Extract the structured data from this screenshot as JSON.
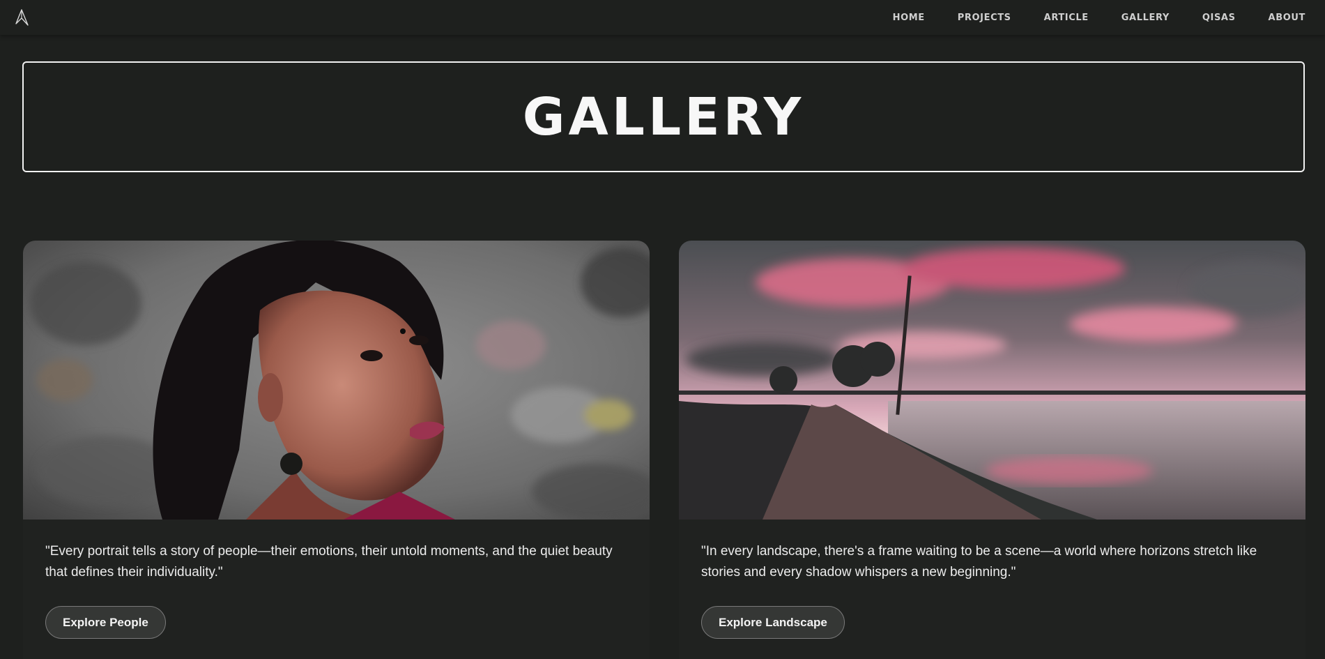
{
  "nav": {
    "items": [
      "HOME",
      "PROJECTS",
      "ARTICLE",
      "GALLERY",
      "QISAS",
      "ABOUT"
    ]
  },
  "hero": {
    "title": "GALLERY"
  },
  "cards": [
    {
      "image": "portrait-photo",
      "quote": "\"Every portrait tells a story of people—their emotions, their untold moments, and the quiet beauty that defines their individuality.\"",
      "button": "Explore People"
    },
    {
      "image": "landscape-sunset-photo",
      "quote": "\"In every landscape, there's a frame waiting to be a scene—a world where horizons stretch like stories and every shadow whispers a new beginning.\"",
      "button": "Explore Landscape"
    }
  ],
  "colors": {
    "background": "#1e201e",
    "text": "#e8e8e8",
    "hero_border": "#f2f2f2",
    "button_bg": "#353735"
  },
  "icons": {
    "logo": "paper-plane-logo-icon"
  }
}
